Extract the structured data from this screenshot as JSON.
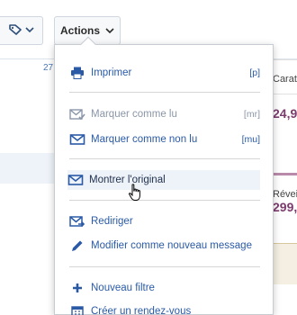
{
  "toolbar": {
    "tag_button": {
      "icon": "tag-icon",
      "chevron": "chevron-down-icon"
    },
    "actions_label": "Actions"
  },
  "background": {
    "side_number": "27",
    "right_column": {
      "text1": "Carat",
      "price1": "24,9",
      "text2": "Réveil",
      "price2": "299,"
    }
  },
  "menu": {
    "print": {
      "label": "Imprimer",
      "shortcut": "[p]"
    },
    "mark_read": {
      "label": "Marquer comme lu",
      "shortcut": "[mr]"
    },
    "mark_unread": {
      "label": "Marquer comme non lu",
      "shortcut": "[mu]"
    },
    "show_original": {
      "label": "Montrer l'original"
    },
    "redirect": {
      "label": "Rediriger"
    },
    "edit_new": {
      "label": "Modifier comme nouveau message"
    },
    "new_filter": {
      "label": "Nouveau filtre"
    },
    "create_appointment": {
      "label": "Créer un rendez-vous"
    }
  },
  "colors": {
    "menu_link": "#2a5aa6",
    "disabled": "#8a96a8",
    "hover_bg": "#eef3f9",
    "price": "#7c3b6d"
  }
}
